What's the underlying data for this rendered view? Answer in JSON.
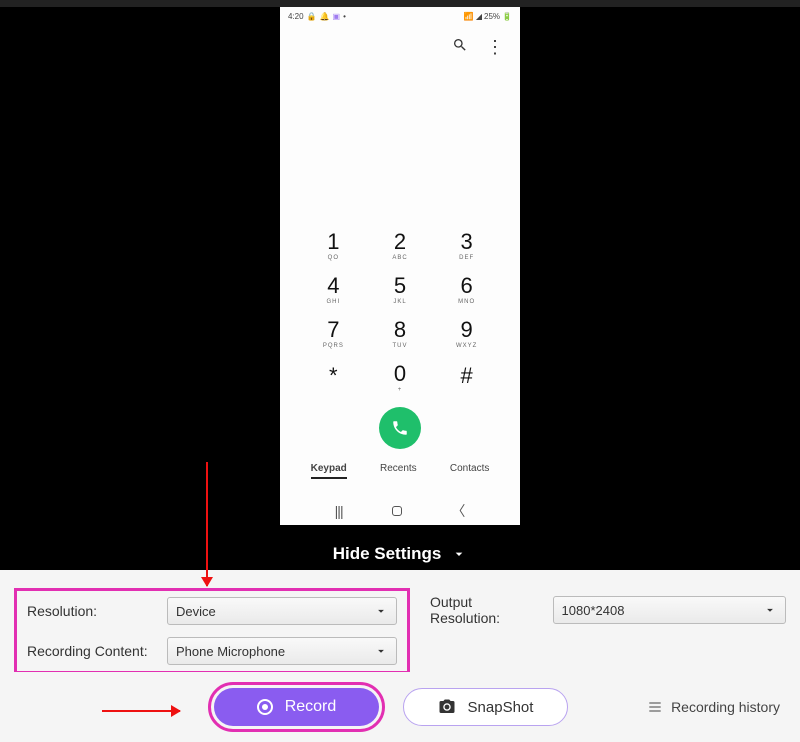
{
  "phone": {
    "status": {
      "time": "4:20",
      "battery": "25%"
    },
    "keys": [
      {
        "n": "1",
        "s": "QO"
      },
      {
        "n": "2",
        "s": "ABC"
      },
      {
        "n": "3",
        "s": "DEF"
      },
      {
        "n": "4",
        "s": "GHI"
      },
      {
        "n": "5",
        "s": "JKL"
      },
      {
        "n": "6",
        "s": "MNO"
      },
      {
        "n": "7",
        "s": "PQRS"
      },
      {
        "n": "8",
        "s": "TUV"
      },
      {
        "n": "9",
        "s": "WXYZ"
      },
      {
        "n": "*",
        "s": ""
      },
      {
        "n": "0",
        "s": "+"
      },
      {
        "n": "#",
        "s": ""
      }
    ],
    "tabs": {
      "keypad": "Keypad",
      "recents": "Recents",
      "contacts": "Contacts"
    }
  },
  "hide_settings": "Hide Settings",
  "settings": {
    "resolution_label": "Resolution:",
    "resolution_value": "Device",
    "recording_label": "Recording Content:",
    "recording_value": "Phone Microphone",
    "output_label": "Output Resolution:",
    "output_value": "1080*2408"
  },
  "actions": {
    "record": "Record",
    "snapshot": "SnapShot",
    "history": "Recording history"
  }
}
